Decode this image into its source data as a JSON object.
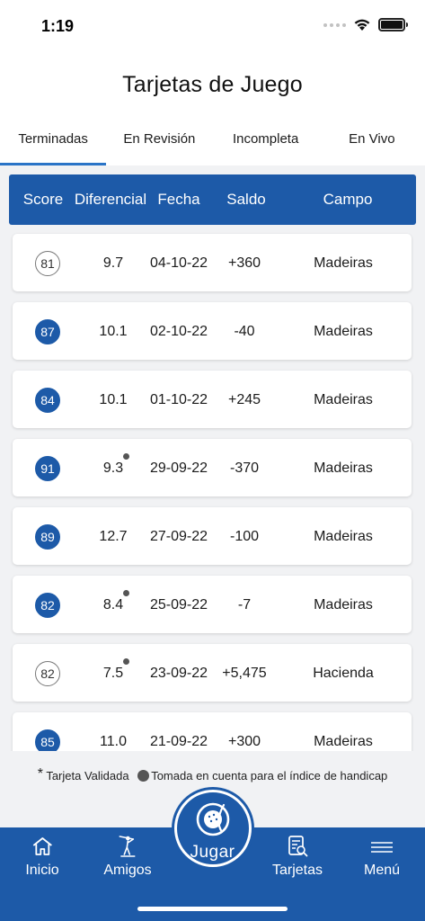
{
  "status_bar": {
    "time": "1:19"
  },
  "header": {
    "title": "Tarjetas de Juego"
  },
  "tabs": [
    {
      "label": "Terminadas",
      "active": true
    },
    {
      "label": "En Revisión",
      "active": false
    },
    {
      "label": "Incompleta",
      "active": false
    },
    {
      "label": "En Vivo",
      "active": false
    }
  ],
  "table": {
    "columns": [
      "Score",
      "Diferencial",
      "Fecha",
      "Saldo",
      "Campo"
    ],
    "rows": [
      {
        "score": "81",
        "style": "outlined",
        "diferencial": "9.7",
        "handicap_dot": false,
        "fecha": "04-10-22",
        "saldo": "+360",
        "campo": "Madeiras"
      },
      {
        "score": "87",
        "style": "filled",
        "diferencial": "10.1",
        "handicap_dot": false,
        "fecha": "02-10-22",
        "saldo": "-40",
        "campo": "Madeiras"
      },
      {
        "score": "84",
        "style": "filled",
        "diferencial": "10.1",
        "handicap_dot": false,
        "fecha": "01-10-22",
        "saldo": "+245",
        "campo": "Madeiras"
      },
      {
        "score": "91",
        "style": "filled",
        "diferencial": "9.3",
        "handicap_dot": true,
        "fecha": "29-09-22",
        "saldo": "-370",
        "campo": "Madeiras"
      },
      {
        "score": "89",
        "style": "filled",
        "diferencial": "12.7",
        "handicap_dot": false,
        "fecha": "27-09-22",
        "saldo": "-100",
        "campo": "Madeiras"
      },
      {
        "score": "82",
        "style": "filled",
        "diferencial": "8.4",
        "handicap_dot": true,
        "fecha": "25-09-22",
        "saldo": "-7",
        "campo": "Madeiras"
      },
      {
        "score": "82",
        "style": "outlined",
        "diferencial": "7.5",
        "handicap_dot": true,
        "fecha": "23-09-22",
        "saldo": "+5,475",
        "campo": "Hacienda"
      },
      {
        "score": "85",
        "style": "filled",
        "diferencial": "11.0",
        "handicap_dot": false,
        "fecha": "21-09-22",
        "saldo": "+300",
        "campo": "Madeiras"
      }
    ]
  },
  "legend": {
    "star": "*",
    "validated": "Tarjeta Validada",
    "handicap": "Tomada en cuenta para el índice de handicap"
  },
  "nav": {
    "items": [
      {
        "label": "Inicio",
        "icon": "home-icon"
      },
      {
        "label": "Amigos",
        "icon": "golfer-icon"
      },
      {
        "label": "Tarjetas",
        "icon": "scorecard-icon"
      },
      {
        "label": "Menú",
        "icon": "menu-icon"
      }
    ],
    "play_label": "Jugar",
    "play_icon": "golf-ball-icon"
  },
  "colors": {
    "primary": "#1d5aa8",
    "tab_indicator": "#2a74c7",
    "background": "#f1f2f4"
  }
}
